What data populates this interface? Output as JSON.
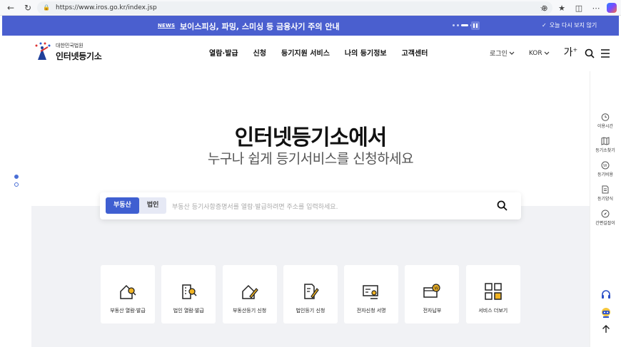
{
  "browser": {
    "url": "https://www.iros.go.kr/index.jsp",
    "icons": [
      "back-icon",
      "refresh-icon",
      "lock-icon",
      "star-icon",
      "extension-icon",
      "favorites-icon",
      "collections-icon",
      "more-icon",
      "copilot-icon"
    ]
  },
  "news": {
    "tag": "NEWS",
    "message": "보이스피싱, 파밍, 스미싱 등 금융사기 주의 안내",
    "close_label": "오늘 다시 보지 않기"
  },
  "header": {
    "logo_small": "대한민국법원",
    "logo_big": "인터넷등기소",
    "gnb": [
      "열람·발급",
      "신청",
      "등기지원 서비스",
      "나의 등기정보",
      "고객센터"
    ],
    "login": "로그인",
    "lang": "KOR",
    "font_size": "가",
    "font_size_plus": "+"
  },
  "hero": {
    "title": "인터넷등기소에서",
    "subtitle": "누구나 쉽게 등기서비스를 신청하세요"
  },
  "search": {
    "tabs": [
      "부동산",
      "법인"
    ],
    "active_tab": "부동산",
    "placeholder": "부동산 등기사항증명서를 열람·발급하려면 주소를 입력하세요."
  },
  "cards": [
    {
      "label": "부동산 열람·발급",
      "icon": "house-search-icon"
    },
    {
      "label": "법인 열람·발급",
      "icon": "building-search-icon"
    },
    {
      "label": "부동산등기 신청",
      "icon": "house-edit-icon"
    },
    {
      "label": "법인등기 신청",
      "icon": "document-edit-icon"
    },
    {
      "label": "전자신청 서명",
      "icon": "e-sign-icon"
    },
    {
      "label": "전자납부",
      "icon": "e-payment-icon"
    },
    {
      "label": "서비스 더보기",
      "icon": "grid-icon"
    }
  ],
  "side": [
    {
      "label": "이용시간",
      "icon": "clock-icon"
    },
    {
      "label": "등기소찾기",
      "icon": "map-icon"
    },
    {
      "label": "등기비용",
      "icon": "won-icon"
    },
    {
      "label": "등기양식",
      "icon": "form-icon"
    },
    {
      "label": "간편길잡이",
      "icon": "compass-icon"
    }
  ],
  "colors": {
    "accent": "#3f5fd1",
    "news_bg": "#4a5fcf",
    "card_accent": "#f0b323"
  }
}
